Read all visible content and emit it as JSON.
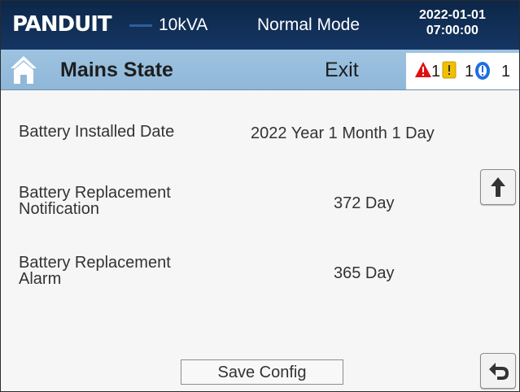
{
  "header": {
    "brand": "PANDUIT",
    "capacity": "10kVA",
    "mode": "Normal Mode",
    "date": "2022-01-01",
    "time": "07:00:00"
  },
  "subheader": {
    "title": "Mains State",
    "exit_label": "Exit",
    "alarms": [
      {
        "icon": "critical-alarm-icon",
        "count": "1",
        "color": "#e01010"
      },
      {
        "icon": "warning-alarm-icon",
        "count": "1",
        "color": "#f0c000"
      },
      {
        "icon": "info-alarm-icon",
        "count": "1",
        "color": "#1d6fe0"
      }
    ]
  },
  "settings": [
    {
      "label": "Battery Installed Date",
      "value": "2022 Year 1 Month 1 Day"
    },
    {
      "label_line1": "Battery Replacement",
      "label_line2": "Notification",
      "value": "372 Day"
    },
    {
      "label_line1": "Battery Replacement",
      "label_line2": "Alarm",
      "value": "365 Day"
    }
  ],
  "footer": {
    "save_label": "Save Config"
  }
}
